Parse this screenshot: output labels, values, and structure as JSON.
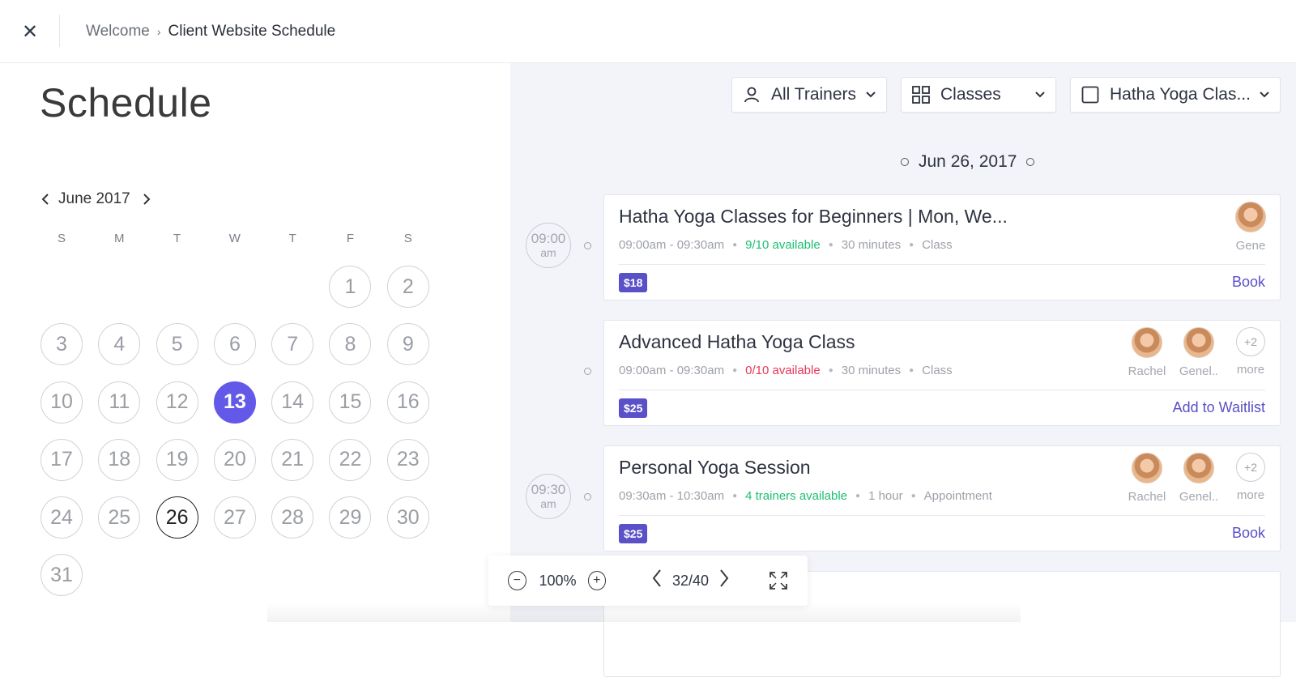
{
  "header": {
    "close_icon": "close-icon",
    "breadcrumb": {
      "parent": "Welcome",
      "separator": "›",
      "current": "Client Website Schedule"
    }
  },
  "left": {
    "title": "Schedule",
    "month_label": "June 2017",
    "weekdays": [
      "S",
      "M",
      "T",
      "W",
      "T",
      "F",
      "S"
    ],
    "leading_blank_days": 5,
    "days": [
      "1",
      "2",
      "3",
      "4",
      "5",
      "6",
      "7",
      "8",
      "9",
      "10",
      "11",
      "12",
      "13",
      "14",
      "15",
      "16",
      "17",
      "18",
      "19",
      "20",
      "21",
      "22",
      "23",
      "24",
      "25",
      "26",
      "27",
      "28",
      "29",
      "30",
      "31"
    ],
    "selected_day": "13",
    "today_day": "26"
  },
  "filters": {
    "trainers": "All Trainers",
    "type": "Classes",
    "class": "Hatha Yoga Clas..."
  },
  "date_header": "Jun 26, 2017",
  "time_badges": [
    {
      "time": "09:00",
      "ampm": "am"
    },
    {
      "time": "09:30",
      "ampm": "am"
    }
  ],
  "cards": [
    {
      "title": "Hatha Yoga Classes for Beginners | Mon, We...",
      "time_range": "09:00am - 09:30am",
      "availability": "9/10 available",
      "duration": "30 minutes",
      "kind": "Class",
      "price": "$18",
      "action": "Book",
      "trainers": [
        "Gene"
      ]
    },
    {
      "title": "Advanced Hatha Yoga Class",
      "time_range": "09:00am - 09:30am",
      "availability": "0/10 available",
      "duration": "30 minutes",
      "kind": "Class",
      "price": "$25",
      "action": "Add to Waitlist",
      "trainers": [
        "Rachel",
        "Genel.."
      ],
      "more_count": "+2",
      "more_label": "more"
    },
    {
      "title": "Personal Yoga Session",
      "time_range": "09:30am - 10:30am",
      "availability": "4 trainers available",
      "duration": "1 hour",
      "kind": "Appointment",
      "price": "$25",
      "action": "Book",
      "trainers": [
        "Rachel",
        "Genel.."
      ],
      "more_count": "+2",
      "more_label": "more"
    }
  ],
  "viewer": {
    "zoom_out": "−",
    "zoom": "100%",
    "zoom_in": "+",
    "prev": "‹",
    "page": "32/40",
    "next": "›"
  },
  "colors": {
    "accent": "#6359e9",
    "price_badge": "#5a50c7",
    "available": "#1dbf73",
    "full": "#e8385a",
    "right_bg": "#f3f4f9"
  }
}
